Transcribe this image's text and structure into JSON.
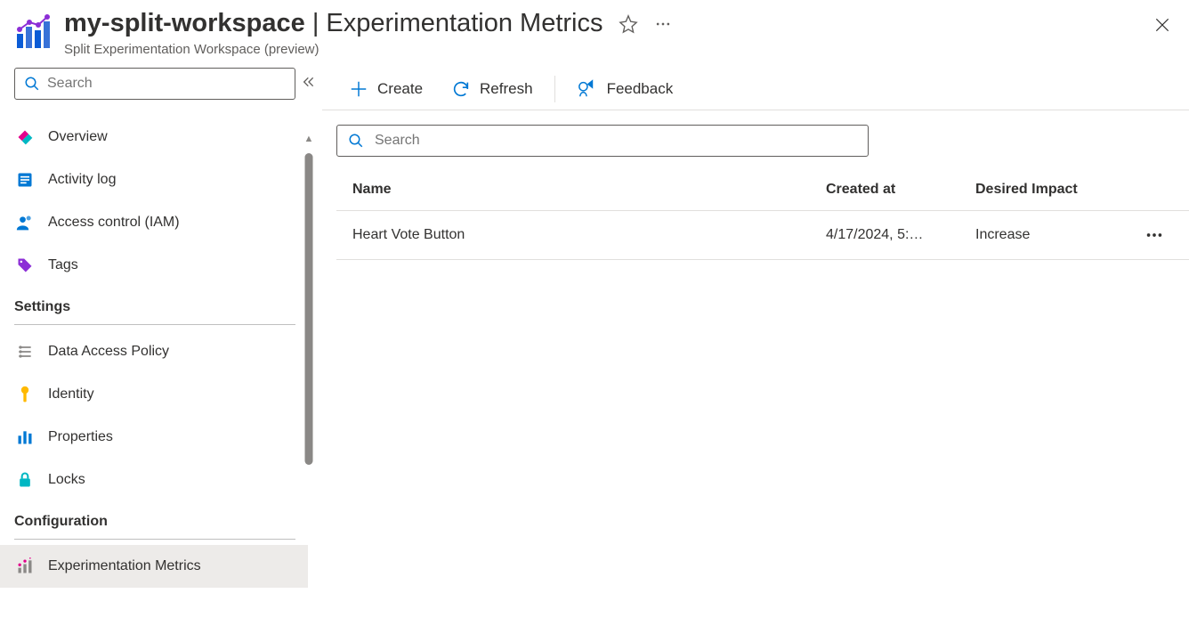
{
  "header": {
    "workspace_name": "my-split-workspace",
    "page_title": "Experimentation Metrics",
    "subtitle": "Split Experimentation Workspace (preview)"
  },
  "sidebar": {
    "search_placeholder": "Search",
    "top_items": [
      {
        "id": "overview",
        "label": "Overview"
      },
      {
        "id": "activity-log",
        "label": "Activity log"
      },
      {
        "id": "access-control",
        "label": "Access control (IAM)"
      },
      {
        "id": "tags",
        "label": "Tags"
      }
    ],
    "settings_label": "Settings",
    "settings_items": [
      {
        "id": "data-access-policy",
        "label": "Data Access Policy"
      },
      {
        "id": "identity",
        "label": "Identity"
      },
      {
        "id": "properties",
        "label": "Properties"
      },
      {
        "id": "locks",
        "label": "Locks"
      }
    ],
    "configuration_label": "Configuration",
    "configuration_items": [
      {
        "id": "experimentation-metrics",
        "label": "Experimentation Metrics",
        "active": true
      }
    ]
  },
  "toolbar": {
    "create_label": "Create",
    "refresh_label": "Refresh",
    "feedback_label": "Feedback"
  },
  "content": {
    "search_placeholder": "Search",
    "columns": {
      "name": "Name",
      "created_at": "Created at",
      "desired_impact": "Desired Impact"
    },
    "rows": [
      {
        "name": "Heart Vote Button",
        "created_at": "4/17/2024, 5:…",
        "desired_impact": "Increase"
      }
    ]
  }
}
